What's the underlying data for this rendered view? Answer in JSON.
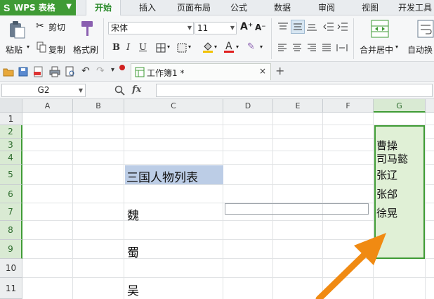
{
  "app": {
    "logo": "S",
    "title": "WPS 表格"
  },
  "tabs": [
    {
      "label": "开始",
      "active": true
    },
    {
      "label": "插入"
    },
    {
      "label": "页面布局"
    },
    {
      "label": "公式"
    },
    {
      "label": "数据"
    },
    {
      "label": "审阅"
    },
    {
      "label": "视图"
    },
    {
      "label": "开发工具"
    }
  ],
  "ribbon": {
    "paste": "粘贴",
    "cut": "剪切",
    "copy": "复制",
    "format_painter": "格式刷",
    "font_name": "宋体",
    "font_size": "11",
    "merge_center": "合并居中",
    "auto_wrap": "自动换"
  },
  "quick_access": {
    "doc_tab": "工作簿1 *",
    "close_symbol": "×",
    "add_symbol": "+"
  },
  "formula_bar": {
    "name_box": "G2",
    "fx": "fx",
    "formula": ""
  },
  "grid": {
    "columns": [
      "A",
      "B",
      "C",
      "D",
      "E",
      "F",
      "G"
    ],
    "rows": [
      "1",
      "2",
      "3",
      "4",
      "5",
      "6",
      "7",
      "8",
      "9",
      "10",
      "11"
    ],
    "cells": {
      "C5": "三国人物列表",
      "C7": "魏",
      "C9": "蜀",
      "C11": "吴",
      "G3": "曹操",
      "G4": "司马懿",
      "G5": "张辽",
      "G6": "张郃",
      "G7": "徐晃"
    },
    "selected_column": "G",
    "selected_rows": [
      "2",
      "3",
      "4",
      "5",
      "6",
      "7",
      "8",
      "9"
    ]
  },
  "colors": {
    "brand_green": "#3f9b35",
    "selection_fill": "#e0f0d6",
    "title_highlight": "#bccde6",
    "arrow_orange": "#f08a12"
  }
}
